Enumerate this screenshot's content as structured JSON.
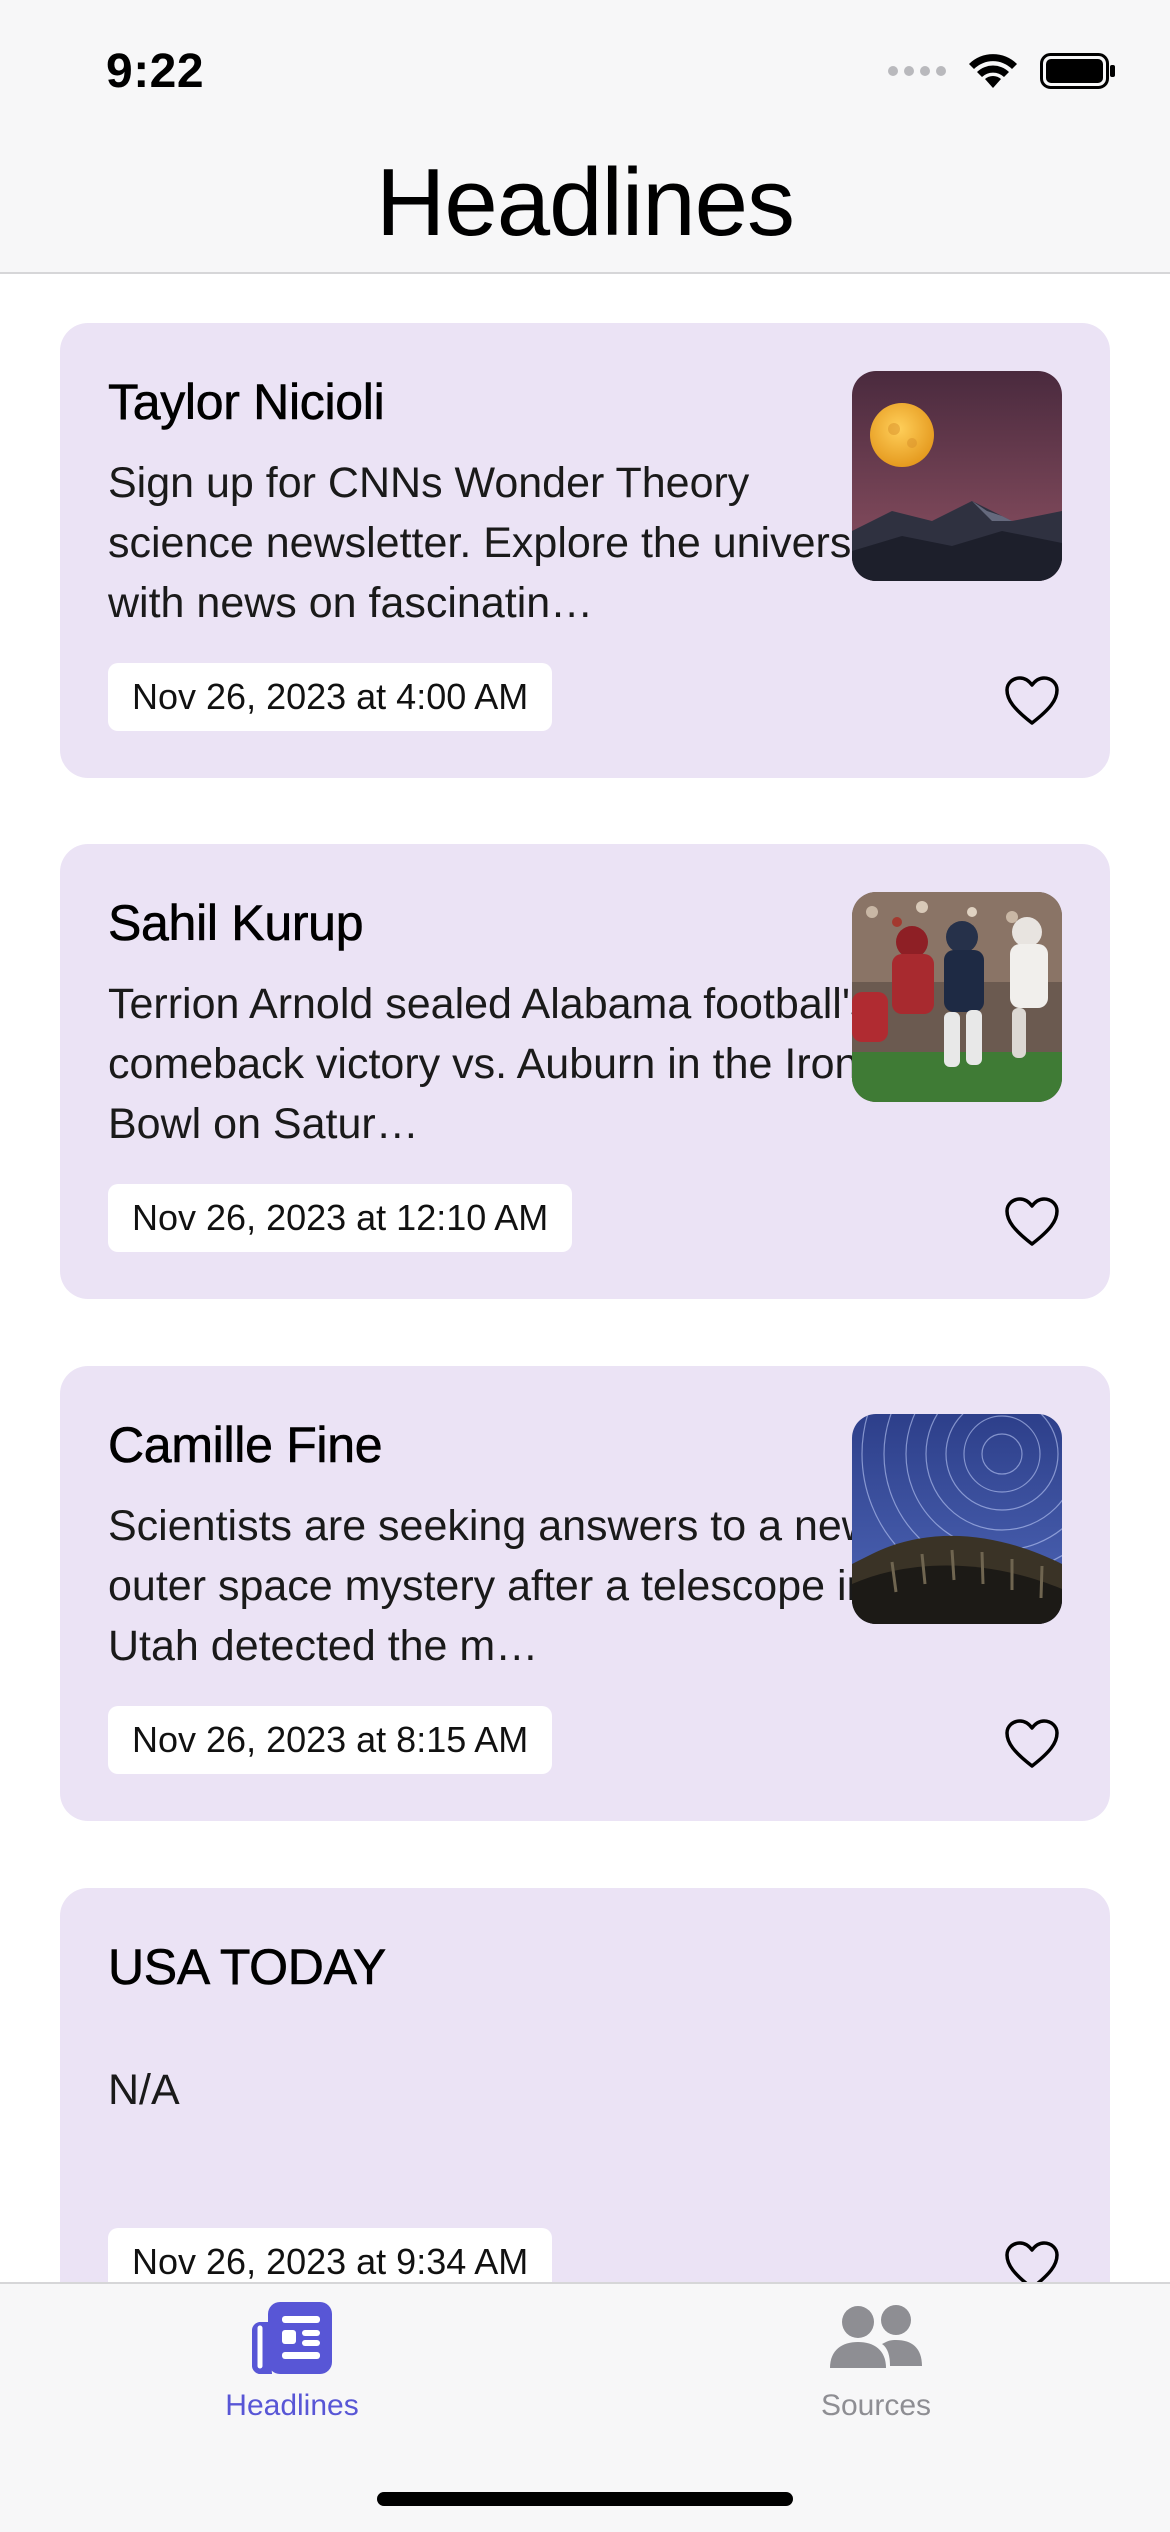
{
  "status_bar": {
    "time": "9:22"
  },
  "nav": {
    "title": "Headlines"
  },
  "articles": [
    {
      "author": "Taylor Nicioli",
      "description": "Sign up for CNNs Wonder Theory science newsletter. Explore the universe with news on fascinatin…",
      "date": "Nov 26, 2023 at 4:00 AM",
      "thumbnail": "moon-over-mountains"
    },
    {
      "author": "Sahil Kurup",
      "description": "Terrion Arnold sealed Alabama football's comeback victory vs. Auburn in the Iron Bowl on Satur…",
      "date": "Nov 26, 2023 at 12:10 AM",
      "thumbnail": "football-game"
    },
    {
      "author": "Camille Fine",
      "description": "Scientists are seeking answers to a new outer space mystery after a telescope in Utah detected the m…",
      "date": "Nov 26, 2023 at 8:15 AM",
      "thumbnail": "star-trails-telescope"
    },
    {
      "author": "USA TODAY",
      "description": "N/A",
      "date": "Nov 26, 2023 at 9:34 AM",
      "thumbnail": ""
    }
  ],
  "tabs": [
    {
      "label": "Headlines",
      "icon": "newspaper-icon",
      "active": true
    },
    {
      "label": "Sources",
      "icon": "people-icon",
      "active": false
    }
  ],
  "colors": {
    "accent": "#5856d6",
    "card_background": "#ebe3f5",
    "inactive_tab": "#8e8e93"
  }
}
